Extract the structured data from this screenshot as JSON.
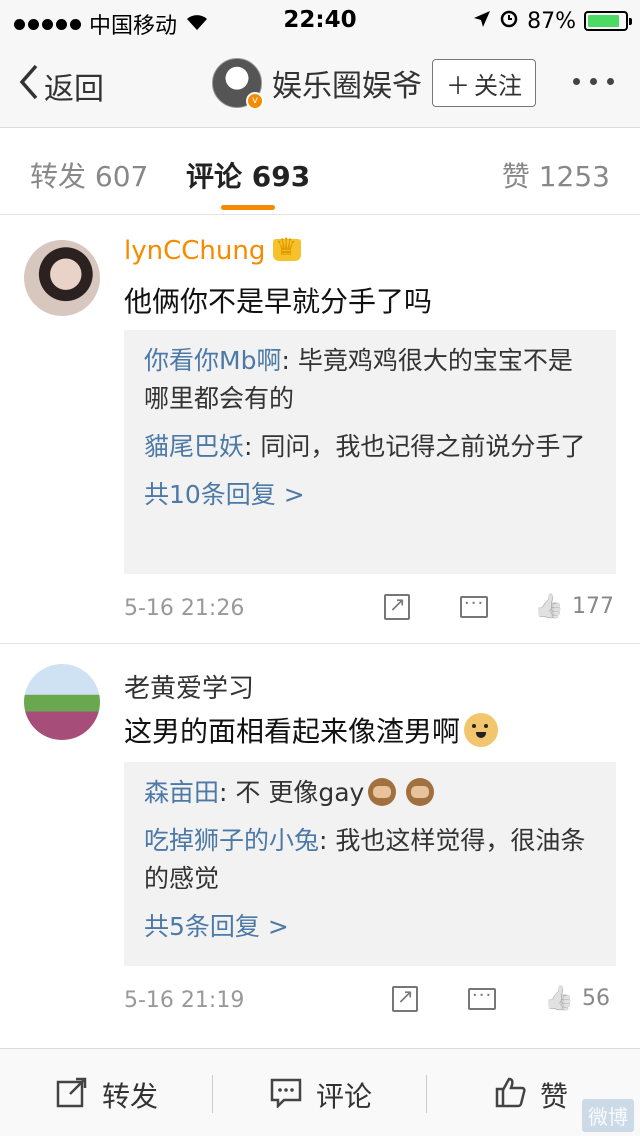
{
  "status_bar": {
    "carrier": "中国移动",
    "time": "22:40",
    "battery_percent": "87%",
    "battery_level": 0.87
  },
  "nav": {
    "back_label": "返回",
    "user_name": "娱乐圈娱爷",
    "follow_label": "关注"
  },
  "tabs": {
    "repost": "转发 607",
    "comments": "评论 693",
    "likes": "赞 1253"
  },
  "comments": [
    {
      "user": "lynCChung",
      "text": "他俩你不是早就分手了吗",
      "replies": [
        {
          "user": "你看你Mb啊",
          "text": ": 毕竟鸡鸡很大的宝宝不是哪里都会有的"
        },
        {
          "user": "貓尾巴妖",
          "text": ": 同问，我也记得之前说分手了"
        }
      ],
      "more_replies": "共10条回复 >",
      "time": "5-16 21:26",
      "like_count": "177"
    },
    {
      "user": "老黄爱学习",
      "text": "这男的面相看起来像渣男啊",
      "replies": [
        {
          "user": "森亩田",
          "text": ": 不 更像gay"
        },
        {
          "user": "吃掉狮子的小兔",
          "text": ": 我也这样觉得，很油条的感觉"
        }
      ],
      "more_replies": "共5条回复 >",
      "time": "5-16 21:19",
      "like_count": "56"
    }
  ],
  "bottom_bar": {
    "repost": "转发",
    "comment": "评论",
    "like": "赞"
  },
  "colors": {
    "accent": "#f78b00",
    "link": "#4d79a7",
    "battery": "#4cd964"
  }
}
